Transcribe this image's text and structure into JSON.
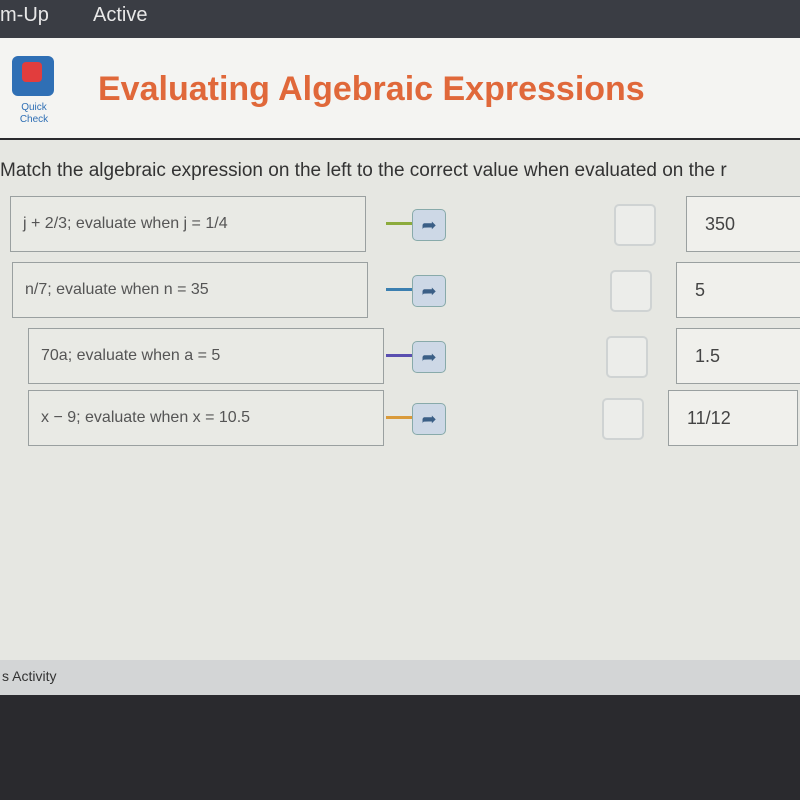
{
  "topbar": {
    "title": "m-Up",
    "status": "Active"
  },
  "header": {
    "icon_label": "Quick Check",
    "title": "Evaluating Algebraic Expressions"
  },
  "instructions": "Match the algebraic expression on the left to the correct value when evaluated on the r",
  "expressions": [
    {
      "text": "j + 2/3;  evaluate when j = 1/4",
      "color": "#8cab3c"
    },
    {
      "text": "n/7;  evaluate when n = 35",
      "color": "#3b7fb0"
    },
    {
      "text": "70a;  evaluate when a = 5",
      "color": "#5a4fb0"
    },
    {
      "text": "x − 9;  evaluate when x = 10.5",
      "color": "#d99a3a"
    }
  ],
  "values": [
    "350",
    "5",
    "1.5",
    "11/12"
  ],
  "footer": {
    "label": "s Activity"
  }
}
